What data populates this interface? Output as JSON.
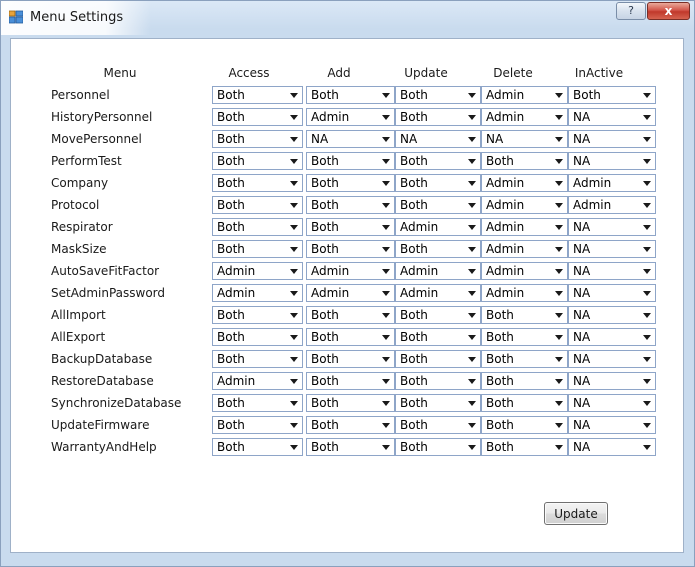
{
  "window": {
    "title": "Menu Settings",
    "help_label": "?",
    "close_label": "x"
  },
  "table": {
    "headers": [
      "Menu",
      "Access",
      "Add",
      "Update",
      "Delete",
      "InActive"
    ],
    "rows": [
      {
        "menu": "Personnel",
        "values": [
          "Both",
          "Both",
          "Both",
          "Admin",
          "Both"
        ]
      },
      {
        "menu": "HistoryPersonnel",
        "values": [
          "Both",
          "Admin",
          "Both",
          "Admin",
          "NA"
        ]
      },
      {
        "menu": "MovePersonnel",
        "values": [
          "Both",
          "NA",
          "NA",
          "NA",
          "NA"
        ]
      },
      {
        "menu": "PerformTest",
        "values": [
          "Both",
          "Both",
          "Both",
          "Both",
          "NA"
        ]
      },
      {
        "menu": "Company",
        "values": [
          "Both",
          "Both",
          "Both",
          "Admin",
          "Admin"
        ]
      },
      {
        "menu": "Protocol",
        "values": [
          "Both",
          "Both",
          "Both",
          "Admin",
          "Admin"
        ]
      },
      {
        "menu": "Respirator",
        "values": [
          "Both",
          "Both",
          "Admin",
          "Admin",
          "NA"
        ]
      },
      {
        "menu": "MaskSize",
        "values": [
          "Both",
          "Both",
          "Both",
          "Admin",
          "NA"
        ]
      },
      {
        "menu": "AutoSaveFitFactor",
        "values": [
          "Admin",
          "Admin",
          "Admin",
          "Admin",
          "NA"
        ]
      },
      {
        "menu": "SetAdminPassword",
        "values": [
          "Admin",
          "Admin",
          "Admin",
          "Admin",
          "NA"
        ]
      },
      {
        "menu": "AllImport",
        "values": [
          "Both",
          "Both",
          "Both",
          "Both",
          "NA"
        ]
      },
      {
        "menu": "AllExport",
        "values": [
          "Both",
          "Both",
          "Both",
          "Both",
          "NA"
        ]
      },
      {
        "menu": "BackupDatabase",
        "values": [
          "Both",
          "Both",
          "Both",
          "Both",
          "NA"
        ]
      },
      {
        "menu": "RestoreDatabase",
        "values": [
          "Admin",
          "Both",
          "Both",
          "Both",
          "NA"
        ]
      },
      {
        "menu": "SynchronizeDatabase",
        "values": [
          "Both",
          "Both",
          "Both",
          "Both",
          "NA"
        ]
      },
      {
        "menu": "UpdateFirmware",
        "values": [
          "Both",
          "Both",
          "Both",
          "Both",
          "NA"
        ]
      },
      {
        "menu": "WarrantyAndHelp",
        "values": [
          "Both",
          "Both",
          "Both",
          "Both",
          "NA"
        ]
      }
    ]
  },
  "actions": {
    "update_label": "Update"
  }
}
